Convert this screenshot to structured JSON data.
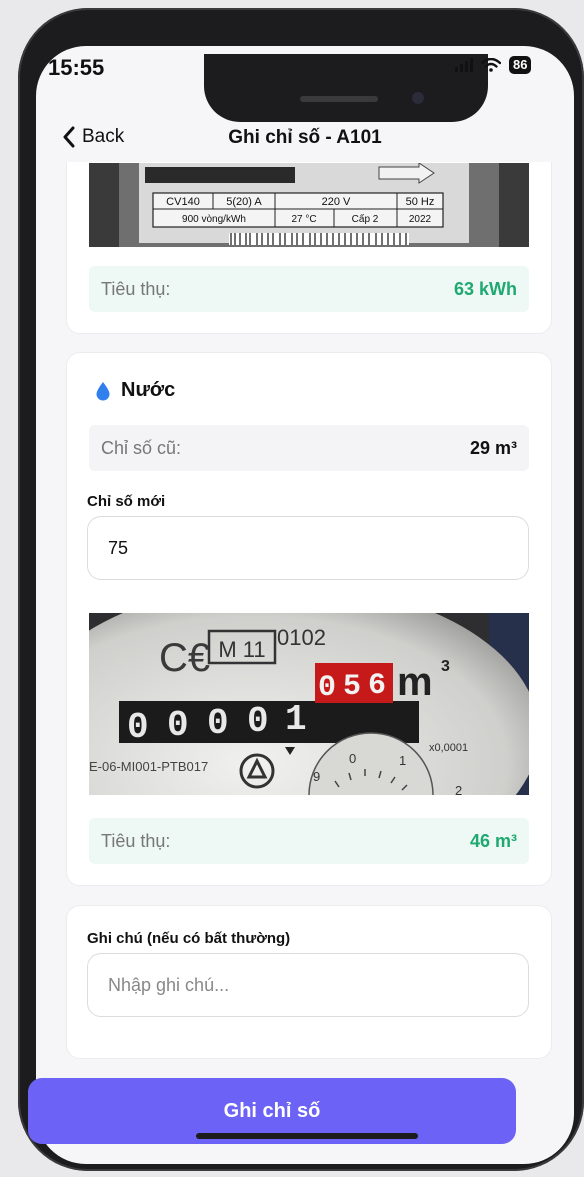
{
  "status_bar": {
    "time": "15:55",
    "battery": "86"
  },
  "nav": {
    "back_label": "Back",
    "title": "Ghi chỉ số - A101"
  },
  "electric": {
    "meter_plate": {
      "row1": [
        "CV140",
        "5(20) A",
        "220 V",
        "50 Hz"
      ],
      "row2": [
        "900 vòng/kWh",
        "27 °C",
        "Cấp 2",
        "2022"
      ]
    },
    "consumption_label": "Tiêu thụ:",
    "consumption_value": "63 kWh"
  },
  "water": {
    "section_title": "Nước",
    "old_label": "Chỉ số cũ:",
    "old_value": "29 m³",
    "new_label": "Chỉ số mới",
    "new_value": "75",
    "meter_photo": {
      "brand_text": "M 11",
      "serial_top": "0102",
      "digits_black": [
        "0",
        "0",
        "0",
        "0",
        "1"
      ],
      "digits_red": [
        "0",
        "5",
        "6"
      ],
      "unit": "m",
      "model_text": "E-06-MI001-PTB017",
      "dial_labels": [
        "9",
        "0",
        "1",
        "x0,0001",
        "2"
      ]
    },
    "consumption_label": "Tiêu thụ:",
    "consumption_value": "46 m³"
  },
  "note": {
    "label": "Ghi chú (nếu có bất thường)",
    "placeholder": "Nhập ghi chú..."
  },
  "submit_label": "Ghi chỉ số",
  "colors": {
    "accent": "#6c63f6",
    "success": "#1fa971",
    "water_drop": "#2f80ed"
  }
}
